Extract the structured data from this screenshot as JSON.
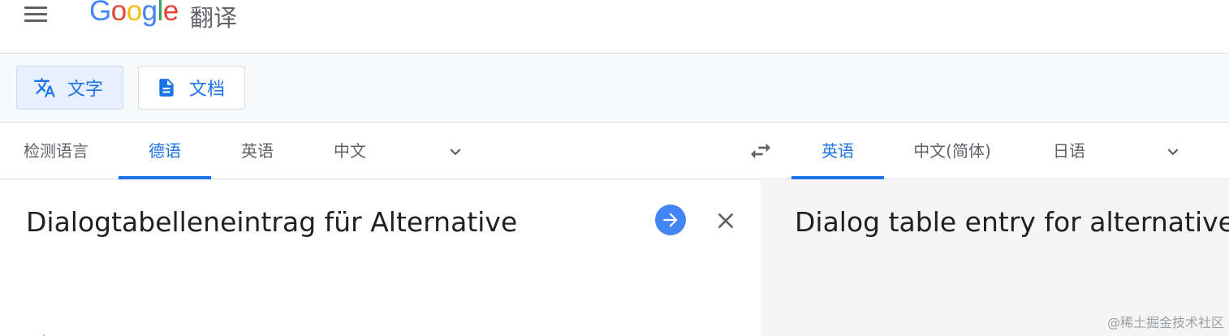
{
  "header": {
    "logo": {
      "G": "G",
      "o1": "o",
      "o2": "o",
      "g": "g",
      "l": "l",
      "e": "e"
    },
    "product_name": "翻译"
  },
  "modes": [
    {
      "label": "文字",
      "active": true,
      "icon": "translate-icon"
    },
    {
      "label": "文档",
      "active": false,
      "icon": "document-icon"
    }
  ],
  "source_langs": [
    {
      "label": "检测语言",
      "active": false
    },
    {
      "label": "德语",
      "active": true
    },
    {
      "label": "英语",
      "active": false
    },
    {
      "label": "中文",
      "active": false
    }
  ],
  "target_langs": [
    {
      "label": "英语",
      "active": true
    },
    {
      "label": "中文(简体)",
      "active": false
    },
    {
      "label": "日语",
      "active": false
    }
  ],
  "source": {
    "text": "Dialogtabelleneintrag für Alternative"
  },
  "target": {
    "text": "Dialog table entry for alternative"
  },
  "watermark": "@稀土掘金技术社区",
  "colors": {
    "accent": "#1a73e8",
    "go_button": "#4285f4",
    "target_bg": "#f5f5f5"
  }
}
